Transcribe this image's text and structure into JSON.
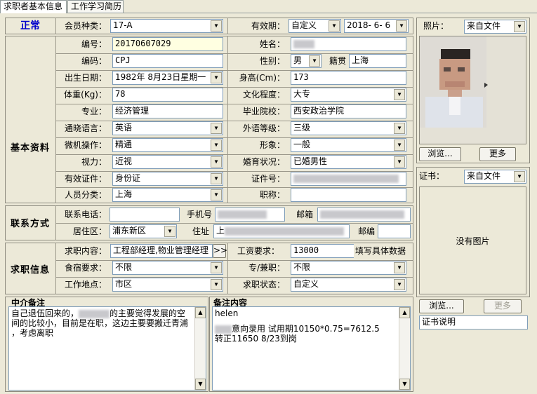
{
  "tabs": [
    {
      "label": "求职者基本信息",
      "active": true
    },
    {
      "label": "工作学习简历",
      "active": false
    }
  ],
  "status": "正常",
  "top": {
    "member_type_label": "会员种类：",
    "member_type_value": "17-A",
    "validity_label": "有效期：",
    "validity_mode": "自定义",
    "validity_date": "2018- 6- 6"
  },
  "basic": {
    "section_label": "基本资料",
    "id_label": "编号：",
    "id_value": "20170607029",
    "name_label": "姓名：",
    "code_label": "编码：",
    "code_value": "CPJ",
    "gender_label": "性别：",
    "gender_value": "男",
    "native_label": "籍贯",
    "native_value": "上海",
    "birth_label": "出生日期：",
    "birth_value": "1982年 8月23日星期一",
    "height_label": "身高(Cm)：",
    "height_value": "173",
    "weight_label": "体重(Kg)：",
    "weight_value": "78",
    "edu_label": "文化程度：",
    "edu_value": "大专",
    "major_label": "专业：",
    "major_value": "经济管理",
    "school_label": "毕业院校：",
    "school_value": "西安政治学院",
    "lang_label": "通晓语言：",
    "lang_value": "英语",
    "lang_level_label": "外语等级：",
    "lang_level_value": "三级",
    "computer_label": "微机操作：",
    "computer_value": "精通",
    "image_label": "形象：",
    "image_value": "一般",
    "vision_label": "视力：",
    "vision_value": "近视",
    "marital_label": "婚育状况：",
    "marital_value": "已婚男性",
    "cert_type_label": "有效证件：",
    "cert_type_value": "身份证",
    "cert_no_label": "证件号：",
    "category_label": "人员分类：",
    "category_value": "上海",
    "title_label": "职称：",
    "title_value": ""
  },
  "contact": {
    "section_label": "联系方式",
    "phone_label": "联系电话：",
    "phone_value": "",
    "mobile_label": "手机号",
    "email_label": "邮箱",
    "district_label": "居住区：",
    "district_value": "浦东新区",
    "address_label": "住址",
    "address_value": "上",
    "postcode_label": "邮编",
    "postcode_value": ""
  },
  "job": {
    "section_label": "求职信息",
    "target_label": "求职内容：",
    "target_value": "工程部经理,物业管理经理",
    "more_btn": ">>",
    "salary_label": "工资要求：",
    "salary_value": "13000",
    "salary_note": "填写具体数据",
    "board_label": "食宿要求：",
    "board_value": "不限",
    "parttime_label": "专/兼职：",
    "parttime_value": "不限",
    "location_label": "工作地点：",
    "location_value": "市区",
    "status_label": "求职状态：",
    "status_value": "自定义"
  },
  "notes": {
    "agent_title": "中介备注",
    "agent_line1_a": "自己退伍回来的，",
    "agent_line1_b": "的主要觉得发展的空",
    "agent_line2": "间的比较小，目前是在职，这边主要要搬迁青浦",
    "agent_line3": "，考虑离职",
    "remark_title": "备注内容",
    "remark_line1": "helen",
    "remark_line2": "意向录用 试用期10150*0.75=7612.5",
    "remark_line3": "转正11650  8/23到岗"
  },
  "photo": {
    "label": "照片：",
    "source": "来自文件",
    "browse_btn": "浏览...",
    "more_btn": "更多"
  },
  "certificate": {
    "label": "证书：",
    "source": "来自文件",
    "no_image": "没有图片",
    "browse_btn": "浏览...",
    "more_btn": "更多",
    "desc": "证书说明"
  },
  "icons": {
    "dropdown": "chevron-down-icon",
    "scroll_up": "triangle-up-icon",
    "scroll_down": "triangle-down-icon"
  }
}
